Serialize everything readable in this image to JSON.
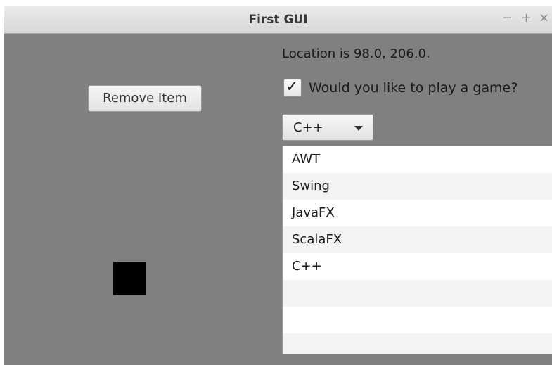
{
  "window": {
    "title": "First GUI",
    "controls": {
      "minimize": "−",
      "maximize": "+",
      "close": "×"
    }
  },
  "left_panel": {
    "remove_button_label": "Remove Item",
    "shape_color": "#000000"
  },
  "right_panel": {
    "location_text": "Location is 98.0, 206.0.",
    "checkbox": {
      "checked": true,
      "label": "Would you like to play a game?"
    },
    "combo": {
      "selected": "C++"
    },
    "list": {
      "items": [
        "AWT",
        "Swing",
        "JavaFX",
        "ScalaFX",
        "C++",
        "",
        "",
        ""
      ]
    }
  },
  "colors": {
    "window_background": "#808080",
    "list_background": "#ffffff",
    "list_alt_row": "#f3f3f3"
  }
}
